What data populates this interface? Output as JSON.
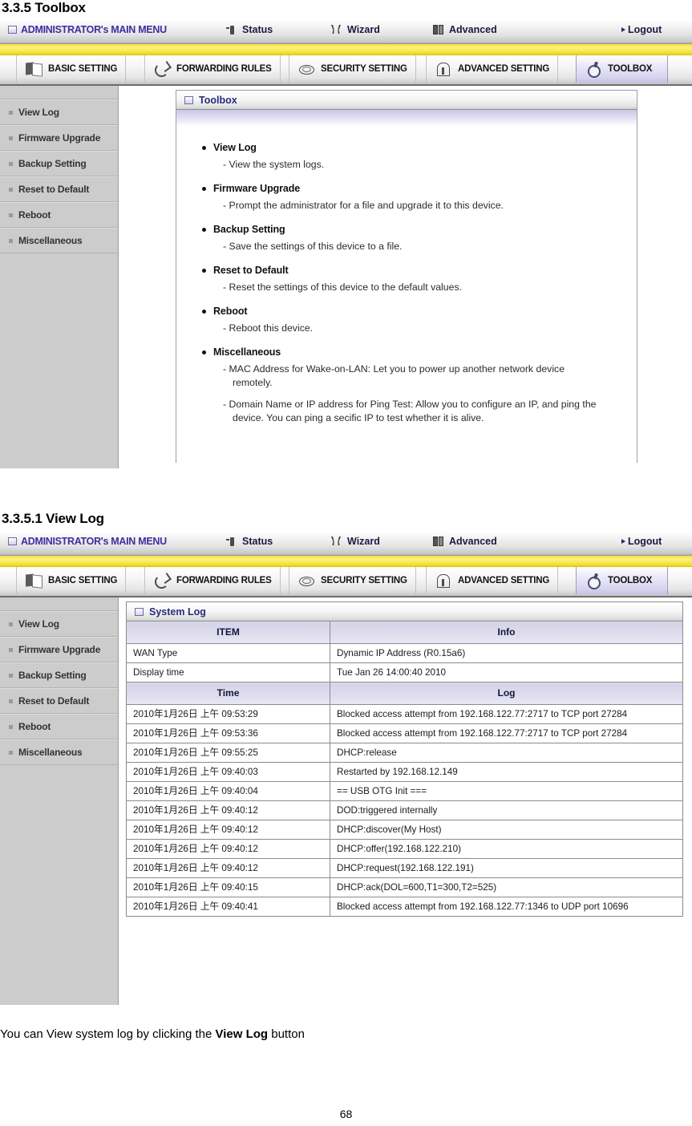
{
  "document": {
    "section_heading": "3.3.5 Toolbox",
    "subsection_heading": "3.3.5.1 View Log",
    "caption_prefix": "You can View system log by clicking the ",
    "caption_bold": "View Log",
    "caption_suffix": " button",
    "page_number": "68"
  },
  "topbar": {
    "main_menu": "ADMINISTRATOR's MAIN MENU",
    "status": "Status",
    "wizard": "Wizard",
    "advanced": "Advanced",
    "logout": "Logout"
  },
  "tabs": [
    {
      "label": "BASIC SETTING",
      "icon": "book-icon",
      "active": false
    },
    {
      "label": "FORWARDING RULES",
      "icon": "forwarding-arrow-icon",
      "active": false
    },
    {
      "label": "SECURITY SETTING",
      "icon": "shell-icon",
      "active": false
    },
    {
      "label": "ADVANCED SETTING",
      "icon": "building-icon",
      "active": false
    },
    {
      "label": "TOOLBOX",
      "icon": "gear-icon",
      "active": true
    }
  ],
  "sidebar": {
    "items": [
      {
        "label": "View Log"
      },
      {
        "label": "Firmware Upgrade"
      },
      {
        "label": "Backup Setting"
      },
      {
        "label": "Reset to Default"
      },
      {
        "label": "Reboot"
      },
      {
        "label": "Miscellaneous"
      }
    ]
  },
  "toolbox_panel": {
    "title": "Toolbox",
    "entries": [
      {
        "term": "View Log",
        "descriptions": [
          "- View the system logs."
        ]
      },
      {
        "term": "Firmware Upgrade",
        "descriptions": [
          "- Prompt the administrator for a file and upgrade it to this device."
        ]
      },
      {
        "term": "Backup Setting",
        "descriptions": [
          "- Save the settings of this device to a file."
        ]
      },
      {
        "term": "Reset to Default",
        "descriptions": [
          "- Reset the settings of this device to the default values."
        ]
      },
      {
        "term": "Reboot",
        "descriptions": [
          "- Reboot this device."
        ]
      },
      {
        "term": "Miscellaneous",
        "descriptions": [
          "- MAC Address for Wake-on-LAN: Let you to power up another network device remotely.",
          "- Domain Name or IP address for Ping Test: Allow you to configure an IP, and ping the device. You can ping a secific IP to test whether it is alive."
        ]
      }
    ]
  },
  "log_panel": {
    "title": "System Log",
    "info_header": {
      "item": "ITEM",
      "info": "Info"
    },
    "info_rows": [
      {
        "item": "WAN Type",
        "info": "Dynamic IP Address (R0.15a6)"
      },
      {
        "item": "Display time",
        "info": "Tue Jan 26 14:00:40 2010"
      }
    ],
    "log_header": {
      "time": "Time",
      "log": "Log"
    },
    "log_rows": [
      {
        "time": "2010年1月26日 上午 09:53:29",
        "log": "Blocked access attempt from 192.168.122.77:2717 to TCP port 27284"
      },
      {
        "time": "2010年1月26日 上午 09:53:36",
        "log": "Blocked access attempt from 192.168.122.77:2717 to TCP port 27284"
      },
      {
        "time": "2010年1月26日 上午 09:55:25",
        "log": "DHCP:release"
      },
      {
        "time": "2010年1月26日 上午 09:40:03",
        "log": "Restarted by 192.168.12.149"
      },
      {
        "time": "2010年1月26日 上午 09:40:04",
        "log": "== USB OTG Init ==="
      },
      {
        "time": "2010年1月26日 上午 09:40:12",
        "log": "DOD:triggered internally"
      },
      {
        "time": "2010年1月26日 上午 09:40:12",
        "log": "DHCP:discover(My Host)"
      },
      {
        "time": "2010年1月26日 上午 09:40:12",
        "log": "DHCP:offer(192.168.122.210)"
      },
      {
        "time": "2010年1月26日 上午 09:40:12",
        "log": "DHCP:request(192.168.122.191)"
      },
      {
        "time": "2010年1月26日 上午 09:40:15",
        "log": "DHCP:ack(DOL=600,T1=300,T2=525)"
      },
      {
        "time": "2010年1月26日 上午 09:40:41",
        "log": "Blocked access attempt from 192.168.122.77:1346 to UDP port 10696"
      }
    ]
  },
  "colors": {
    "accent_purple": "#3b2fa0",
    "yellow_band": "#f4e23a",
    "sidebar_gray": "#cccccc",
    "table_header_lavender": "#dcdaec",
    "active_tab": "#d7d4ef"
  }
}
